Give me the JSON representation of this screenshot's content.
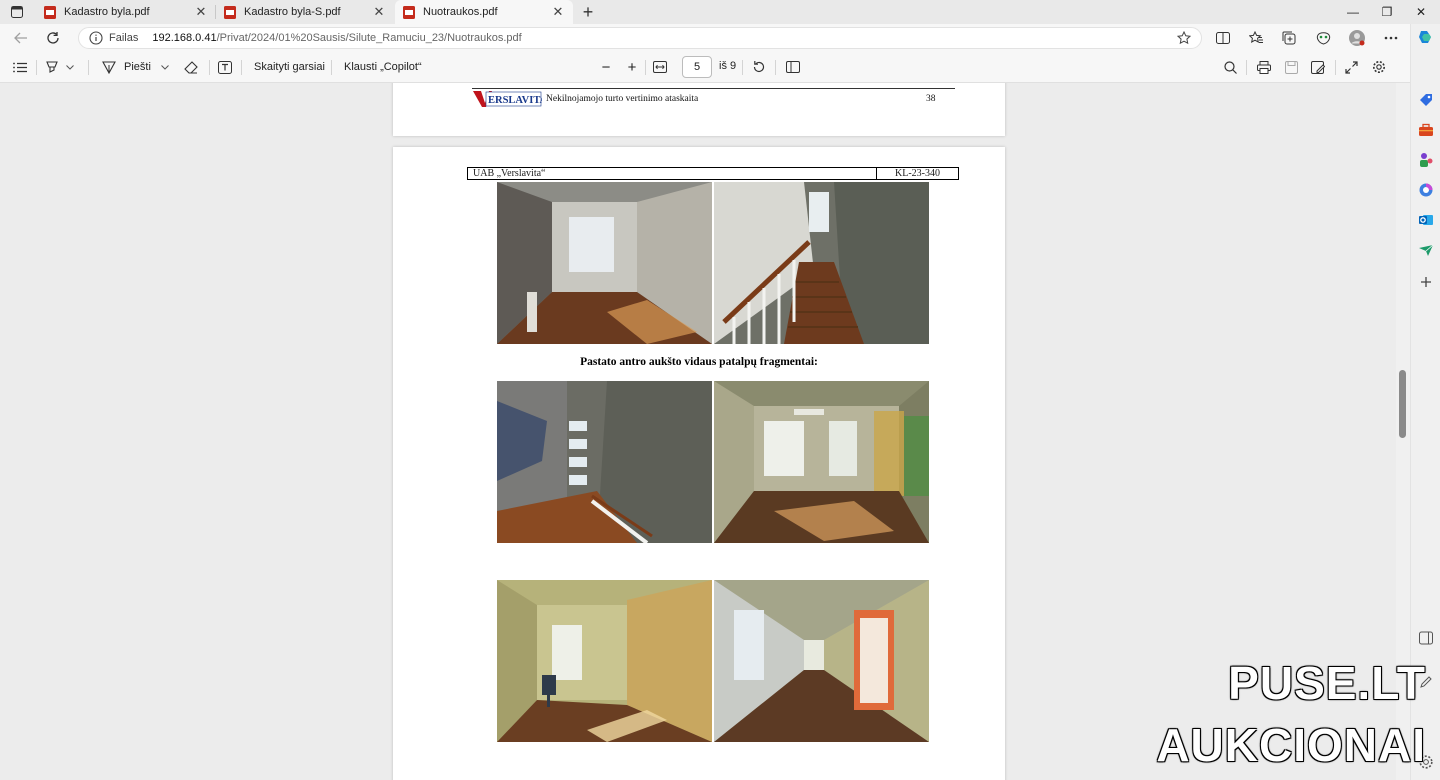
{
  "tabs": [
    {
      "title": "Kadastro byla.pdf",
      "close": "✕"
    },
    {
      "title": "Kadastro byla-S.pdf",
      "close": "✕"
    },
    {
      "title": "Nuotraukos.pdf",
      "close": "✕"
    }
  ],
  "new_tab": "+",
  "window_controls": {
    "minimize": "—",
    "restore": "❐",
    "close": "✕"
  },
  "address": {
    "scheme_label": "Failas",
    "host": "192.168.0.41",
    "path": "/Privat/2024/01%20Sausis/Silute_Ramuciu_23/Nuotraukos.pdf"
  },
  "pdf_toolbar": {
    "draw_label": "Piešti",
    "read_aloud_label": "Skaityti garsiai",
    "copilot_label": "Klausti „Copilot“",
    "zoom_out": "−",
    "zoom_in": "+",
    "page_current": "5",
    "page_total": "iš 9"
  },
  "document": {
    "prev_page": {
      "logo_text": "ERSLAVITA",
      "header_text": "Nekilnojamojo turto vertinimo ataskaita",
      "page_number": "38"
    },
    "current_page": {
      "company": "UAB „Verslavita“",
      "code": "KL-23-340",
      "caption": "Pastato antro aukšto vidaus patalpų fragmentai:"
    }
  },
  "watermark": {
    "line1": "PUSE.LT",
    "line2": "AUKCIONAI"
  },
  "colors": {
    "accent": "#0067c0",
    "pdf_red": "#c42b1c",
    "logo_red": "#c0141c",
    "logo_blue": "#1a3a8c"
  }
}
